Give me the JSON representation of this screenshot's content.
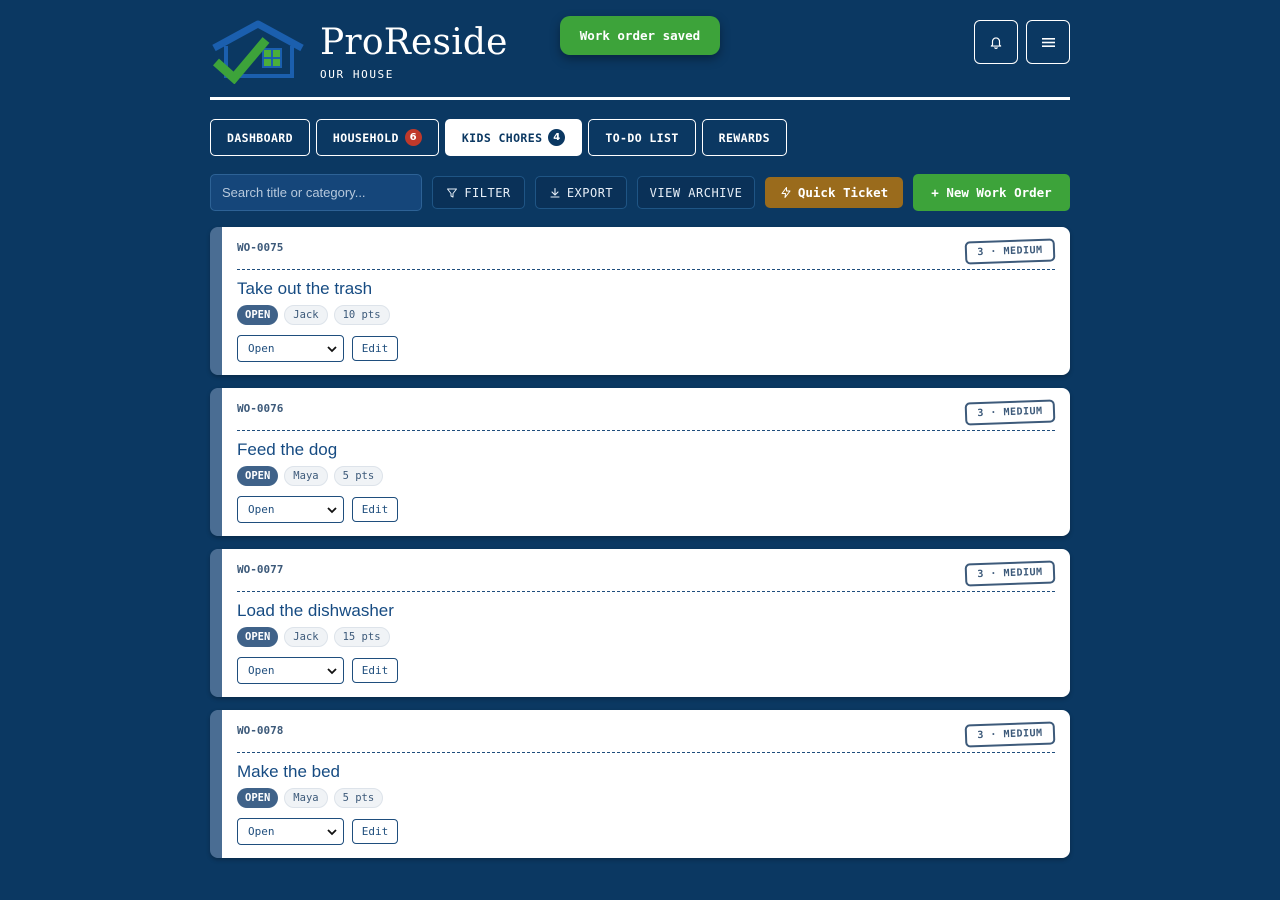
{
  "brand": {
    "name": "ProReside",
    "subtitle": "OUR HOUSE"
  },
  "toast": {
    "message": "Work order saved"
  },
  "header_buttons": {
    "notifications_icon": "bell-icon",
    "menu_icon": "hamburger-icon"
  },
  "tabs": [
    {
      "label": "DASHBOARD",
      "count": null,
      "active": false
    },
    {
      "label": "HOUSEHOLD",
      "count": "6",
      "active": false
    },
    {
      "label": "KIDS CHORES",
      "count": "4",
      "active": true
    },
    {
      "label": "TO-DO LIST",
      "count": null,
      "active": false
    },
    {
      "label": "REWARDS",
      "count": null,
      "active": false
    }
  ],
  "toolbar": {
    "search_placeholder": "Search title or category...",
    "filter_label": "FILTER",
    "export_label": "EXPORT",
    "archive_label": "VIEW ARCHIVE",
    "quick_label": "Quick Ticket",
    "new_label": "+ New Work Order"
  },
  "work_orders": [
    {
      "id": "WO-0075",
      "priority": "3 · MEDIUM",
      "title": "Take out the trash",
      "status": "OPEN",
      "assignee": "Jack",
      "points": "10 pts",
      "select_value": "Open",
      "edit_label": "Edit"
    },
    {
      "id": "WO-0076",
      "priority": "3 · MEDIUM",
      "title": "Feed the dog",
      "status": "OPEN",
      "assignee": "Maya",
      "points": "5 pts",
      "select_value": "Open",
      "edit_label": "Edit"
    },
    {
      "id": "WO-0077",
      "priority": "3 · MEDIUM",
      "title": "Load the dishwasher",
      "status": "OPEN",
      "assignee": "Jack",
      "points": "15 pts",
      "select_value": "Open",
      "edit_label": "Edit"
    },
    {
      "id": "WO-0078",
      "priority": "3 · MEDIUM",
      "title": "Make the bed",
      "status": "OPEN",
      "assignee": "Maya",
      "points": "5 pts",
      "select_value": "Open",
      "edit_label": "Edit"
    }
  ],
  "colors": {
    "background": "#0b3862",
    "success": "#3da33a",
    "quick": "#9a6b1c",
    "badge_red": "#c0392b"
  }
}
